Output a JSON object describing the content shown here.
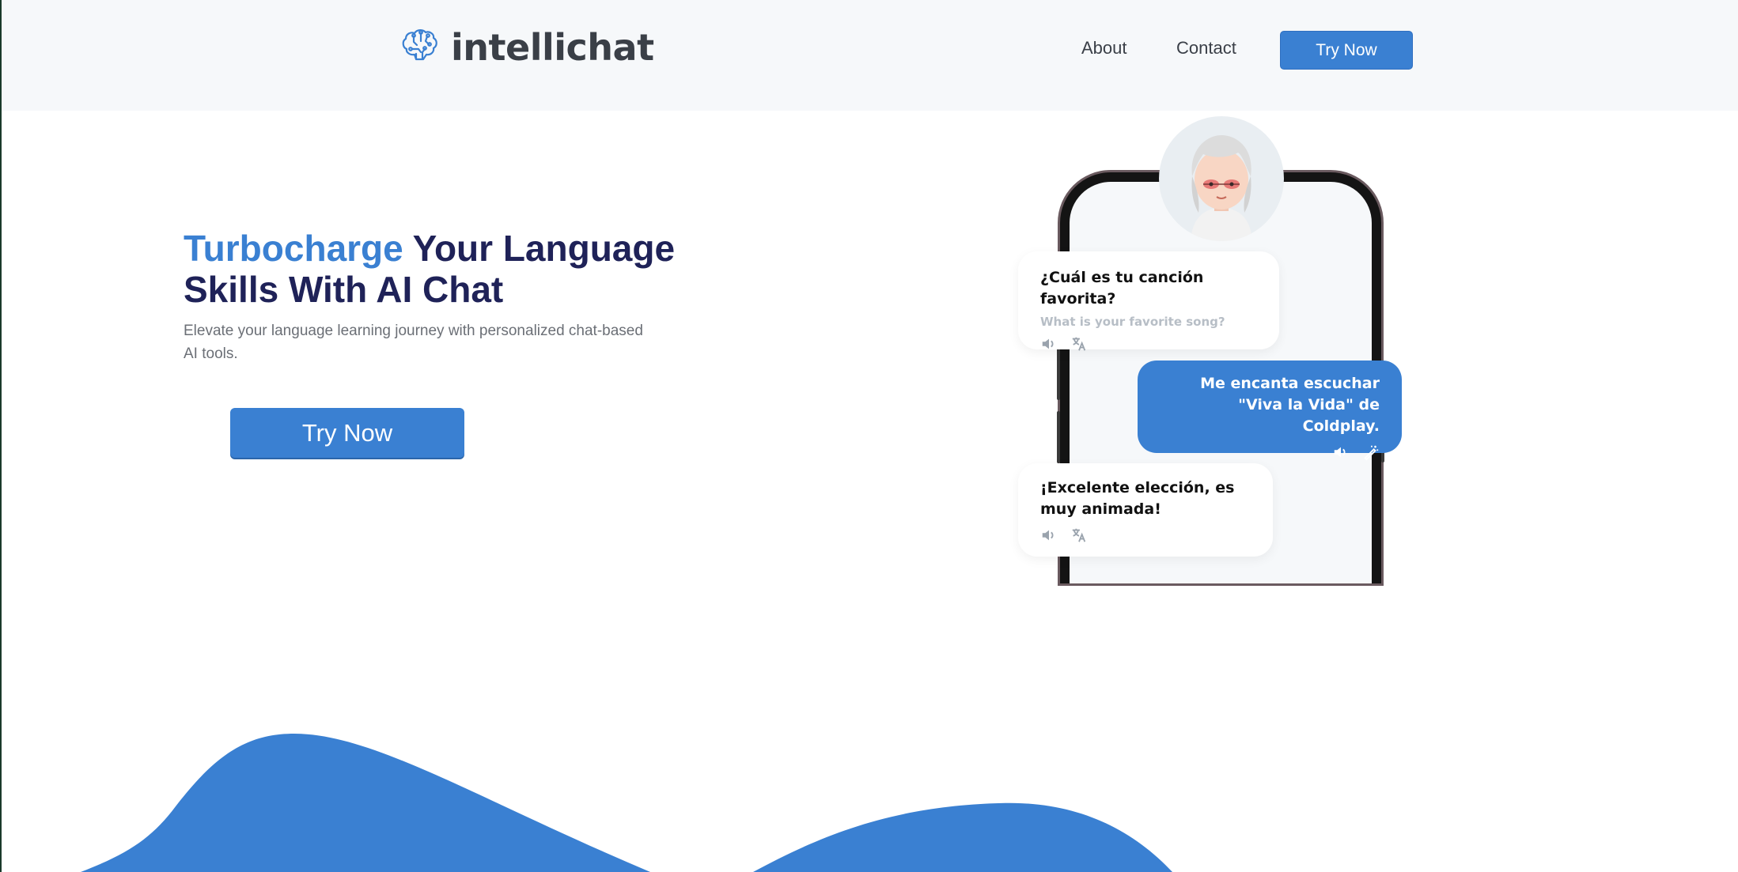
{
  "header": {
    "brand": "intellichat",
    "nav": {
      "about": "About",
      "contact": "Contact",
      "cta": "Try Now"
    }
  },
  "hero": {
    "title_accent": "Turbocharge",
    "title_rest": " Your Language Skills With AI Chat",
    "subtitle": "Elevate your language learning journey with personalized chat-based AI tools.",
    "cta": "Try Now"
  },
  "chat": {
    "messages": [
      {
        "side": "left",
        "text": "¿Cuál es tu canción favorita?",
        "translation": "What is your favorite song?",
        "icons": [
          "speaker-icon",
          "translate-icon"
        ]
      },
      {
        "side": "right",
        "text": "Me encanta escuchar \"Viva la Vida\" de Coldplay.",
        "icons": [
          "speaker-icon",
          "magic-wand-icon"
        ]
      },
      {
        "side": "left",
        "text": "¡Excelente elección, es muy animada!",
        "icons": [
          "speaker-icon",
          "translate-icon"
        ]
      }
    ]
  },
  "colors": {
    "accent": "#3a80d2",
    "title": "#1f2258",
    "header_bg": "#f6f8fa",
    "text_muted": "#6b6f76"
  }
}
